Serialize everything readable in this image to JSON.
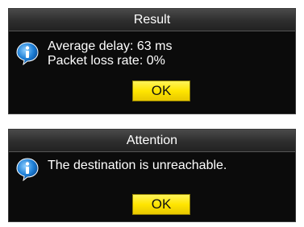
{
  "result_dialog": {
    "title": "Result",
    "lines": [
      "Average delay: 63 ms",
      "Packet loss rate: 0%"
    ],
    "ok_label": "OK",
    "icon": "info-icon"
  },
  "attention_dialog": {
    "title": "Attention",
    "lines": [
      "The destination is unreachable."
    ],
    "ok_label": "OK",
    "icon": "info-icon"
  },
  "colors": {
    "dialog_bg": "#0b0b0b",
    "title_bar": "#2e2e2e",
    "button": "#ffe500",
    "icon_blue": "#1e7fd6"
  }
}
